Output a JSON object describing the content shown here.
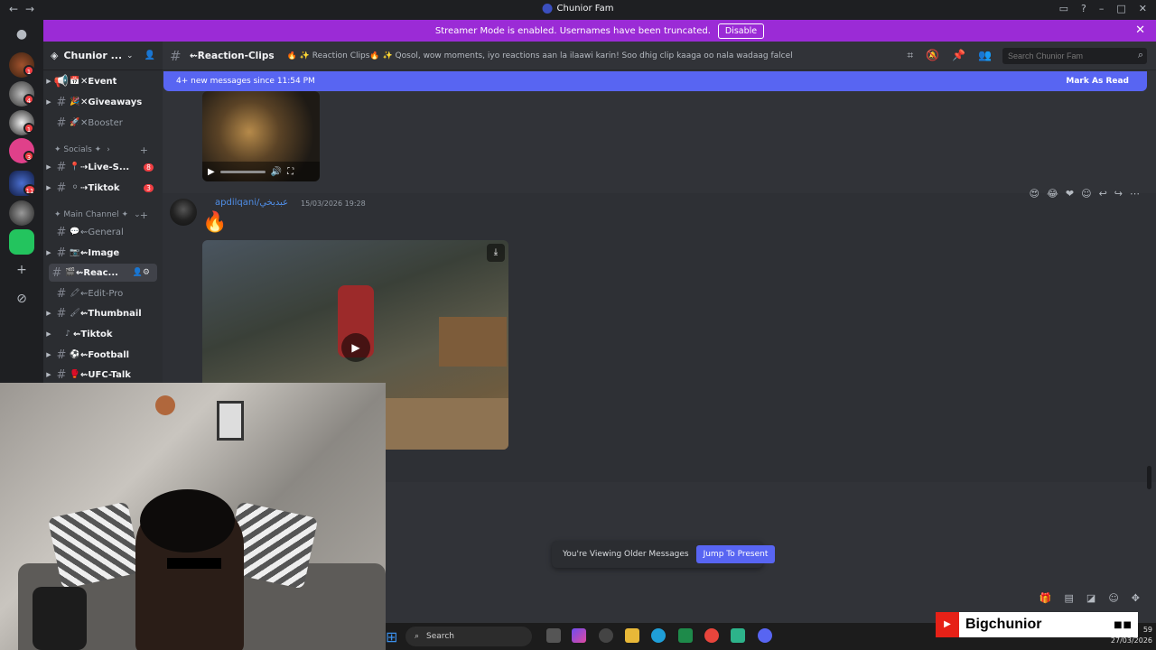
{
  "window": {
    "title": "Chunior Fam"
  },
  "banner": {
    "text": "Streamer Mode is enabled. Usernames have been truncated.",
    "disable_label": "Disable"
  },
  "rail": {
    "badges": [
      "1",
      "4",
      "1",
      "3",
      "11"
    ]
  },
  "server": {
    "name": "Chunior ..."
  },
  "channels": [
    {
      "emoji": "📅",
      "label": "✕Event",
      "dim": false
    },
    {
      "emoji": "🎉",
      "label": "✕Giveaways",
      "dim": false
    },
    {
      "emoji": "🚀",
      "label": "✕Booster",
      "dim": true
    }
  ],
  "categories": {
    "socials": "✦ Socials ✦",
    "main": "✦ Main Channel ✦"
  },
  "social_channels": [
    {
      "emoji": "📍",
      "label": "⇢Live-S...",
      "badge": "8"
    },
    {
      "emoji": "⚪",
      "label": "⇢Tiktok",
      "badge": "3"
    }
  ],
  "main_channels": [
    {
      "emoji": "💬",
      "label": "⇜General"
    },
    {
      "emoji": "📷",
      "label": "⇜Image"
    },
    {
      "emoji": "🎬",
      "label": "⇜Reac..."
    },
    {
      "emoji": "🖍",
      "label": "⇜Edit-Pro"
    },
    {
      "emoji": "🖌",
      "label": "⇜Thumbnail"
    },
    {
      "emoji": "♪",
      "label": "⇜Tiktok"
    },
    {
      "emoji": "⚽",
      "label": "⇜Football"
    },
    {
      "emoji": "🥊",
      "label": "⇜UFC-Talk"
    }
  ],
  "channel_header": {
    "name": "⇜Reaction-Clips",
    "topic": "🔥 ✨ Reaction Clips🔥 ✨ Qosol, wow moments, iyo reactions aan la ilaawi karin! Soo dhig clip kaaga oo nala wadaag falcelintaada 😆",
    "search_placeholder": "Search Chunior Fam"
  },
  "new_messages": {
    "text": "4+ new messages since 11:54 PM",
    "mark_label": "Mark As Read"
  },
  "message": {
    "author": "apdilqani/عبدبخي",
    "timestamp": "15/03/2026 19:28",
    "content": "🔥"
  },
  "older_bar": {
    "text": "You're Viewing Older Messages",
    "jump_label": "Jump To Present"
  },
  "taskbar": {
    "search_label": "Search",
    "time": "59",
    "date": "27/03/2026"
  },
  "stream_tag": {
    "name": "Bigchunior"
  },
  "colors": {
    "banner": "#9b2bd6",
    "accent": "#5865f2",
    "badge": "#f23f43",
    "author": "#4f8ee8"
  }
}
